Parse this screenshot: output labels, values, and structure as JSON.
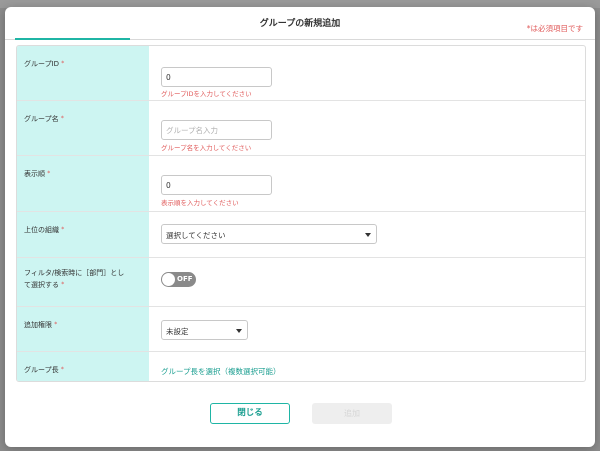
{
  "modal": {
    "title": "グループの新規追加",
    "required_note": "*は必須項目です"
  },
  "fields": {
    "group_id": {
      "label": "グループID",
      "value": "0",
      "error": "グループIDを入力してください"
    },
    "group_name": {
      "label": "グループ名",
      "placeholder": "グループ名入力",
      "value": "",
      "error": "グループ名を入力してください"
    },
    "display_order": {
      "label": "表示順",
      "value": "0",
      "error": "表示順を入力してください"
    },
    "parent_org": {
      "label": "上位の組織",
      "selected": "選択してください"
    },
    "filter_dept": {
      "label_line1": "フィルタ/検索時に［部門］とし",
      "label_line2": "て選択する",
      "toggle_state": "OFF"
    },
    "add_permission": {
      "label": "追加権限",
      "selected": "未設定"
    },
    "group_leader": {
      "label": "グループ長",
      "link": "グループ長を選択（複数選択可能）"
    }
  },
  "footer": {
    "close_label": "閉じる",
    "add_label": "追加"
  },
  "colors": {
    "accent": "#1fb5a5",
    "label_bg": "#cdf5f2",
    "error": "#e05a5a"
  },
  "required_mark": "*"
}
